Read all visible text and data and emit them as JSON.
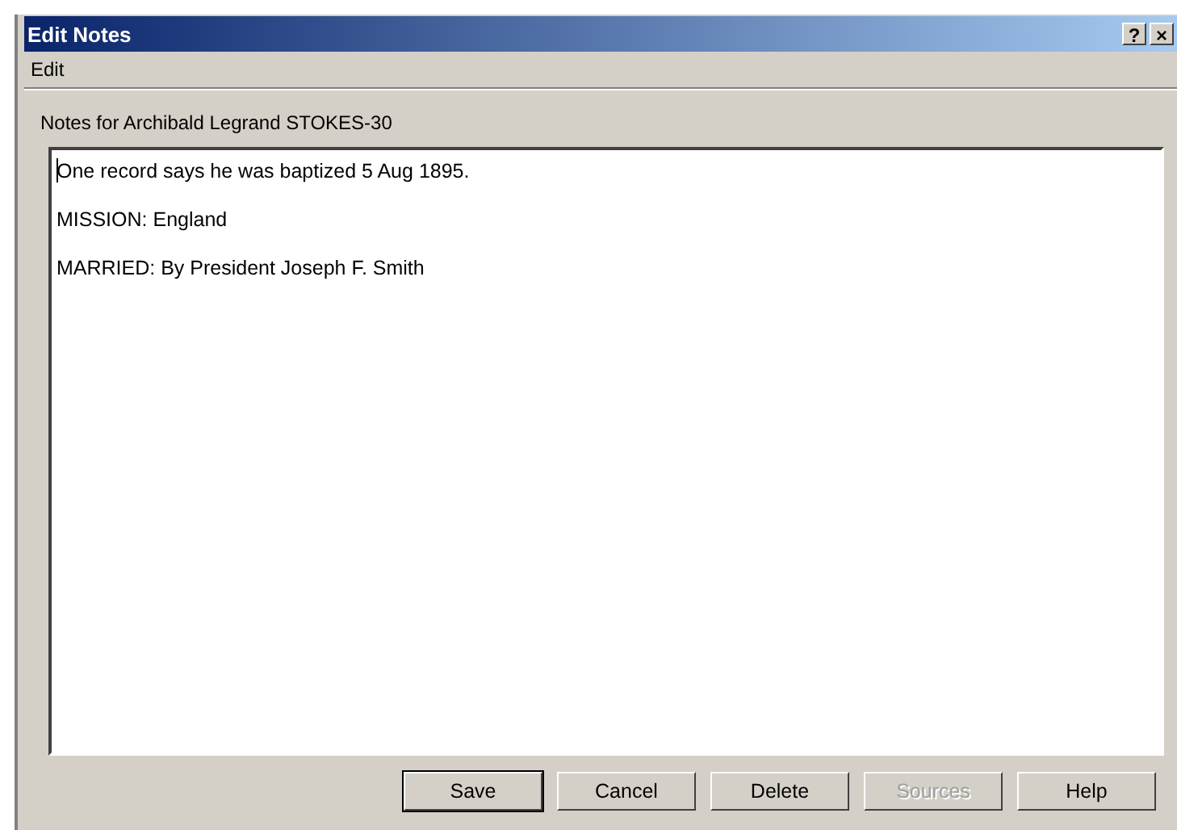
{
  "window": {
    "title": "Edit Notes",
    "caption_buttons": [
      "?",
      "×"
    ]
  },
  "menu": [
    {
      "label": "Edit"
    }
  ],
  "notes_label": "Notes for Archibald Legrand STOKES-30",
  "notes": [
    "One record says he was baptized 5 Aug 1895.",
    "MISSION: England",
    "MARRIED: By President Joseph F. Smith"
  ],
  "buttons": [
    {
      "label": "Save",
      "default": true,
      "disabled": false
    },
    {
      "label": "Cancel",
      "default": false,
      "disabled": false
    },
    {
      "label": "Delete",
      "default": false,
      "disabled": false
    },
    {
      "label": "Sources",
      "default": false,
      "disabled": true
    },
    {
      "label": "Help",
      "default": false,
      "disabled": false
    }
  ]
}
